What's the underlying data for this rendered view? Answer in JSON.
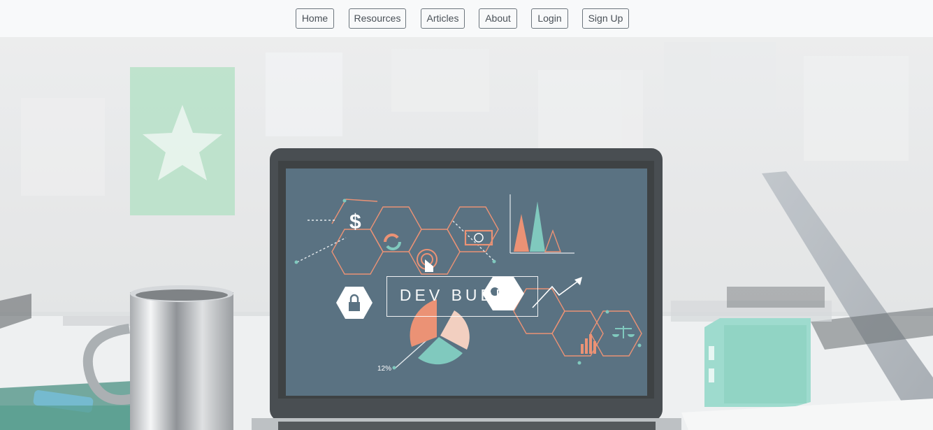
{
  "nav": {
    "items": [
      {
        "label": "Home"
      },
      {
        "label": "Resources"
      },
      {
        "label": "Articles"
      },
      {
        "label": "About"
      },
      {
        "label": "Login"
      },
      {
        "label": "Sign Up"
      }
    ]
  },
  "hero": {
    "brand": "DEV BUDDY",
    "screen_percent_label": "12%",
    "overlay_color": "#ffffff",
    "screen_color": "#3f5b6e",
    "accent_colors": {
      "orange": "#e8815f",
      "teal": "#6cc1b4",
      "peach": "#f0c7b6",
      "mint_speaker": "#8fd6c6",
      "sticky_note": "#a8dcbc"
    },
    "icons": [
      "dollar-icon",
      "refresh-icon",
      "touch-icon",
      "money-icon",
      "lock-icon",
      "key-icon",
      "scale-icon",
      "pie-chart-icon",
      "bar-chart-icon",
      "trend-arrow-icon"
    ]
  }
}
